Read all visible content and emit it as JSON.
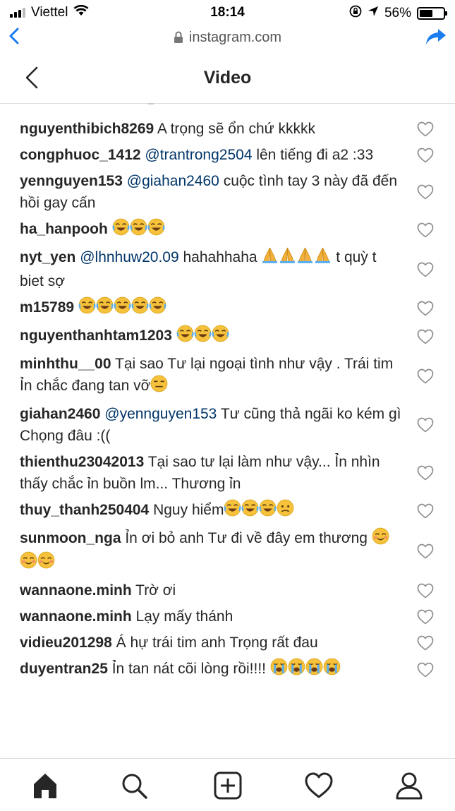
{
  "status_bar": {
    "carrier": "Viettel",
    "time": "18:14",
    "battery_text": "56%",
    "battery_level": 0.56
  },
  "browser": {
    "url": "instagram.com"
  },
  "header": {
    "title": "Video"
  },
  "comments": [
    {
      "user": "nguyenthibich8269",
      "parts": [
        {
          "t": " A trọng sẽ ổn chứ kkkkk"
        }
      ]
    },
    {
      "user": "congphuoc_1412",
      "parts": [
        {
          "t": " "
        },
        {
          "m": "@trantrong2504"
        },
        {
          "t": " lên tiếng đi a2 :33"
        }
      ]
    },
    {
      "user": "yennguyen153",
      "parts": [
        {
          "t": " "
        },
        {
          "m": "@giahan2460"
        },
        {
          "t": " cuộc tình tay 3 này đã đến hồi gay cấn"
        }
      ]
    },
    {
      "user": "ha_hanpooh",
      "parts": [
        {
          "t": " "
        },
        {
          "e": "joy"
        },
        {
          "e": "joy"
        },
        {
          "e": "joy"
        }
      ]
    },
    {
      "user": "nyt_yen",
      "parts": [
        {
          "t": " "
        },
        {
          "m": "@lhnhuw20.09"
        },
        {
          "t": " hahahhaha "
        },
        {
          "e": "pray"
        },
        {
          "e": "pray"
        },
        {
          "e": "pray"
        },
        {
          "e": "pray"
        },
        {
          "t": " t quỳ t biet sợ"
        }
      ]
    },
    {
      "user": "m15789",
      "parts": [
        {
          "t": " "
        },
        {
          "e": "joy"
        },
        {
          "e": "joy"
        },
        {
          "e": "joy"
        },
        {
          "e": "joy"
        },
        {
          "e": "joy"
        }
      ]
    },
    {
      "user": "nguyenthanhtam1203",
      "parts": [
        {
          "t": " "
        },
        {
          "e": "joy"
        },
        {
          "e": "joy"
        },
        {
          "e": "joy"
        }
      ]
    },
    {
      "user": "minhthu__00",
      "parts": [
        {
          "t": " Tại sao Tư lại ngoại tình như vậy . Trái tim Ỉn chắc đang tan vỡ"
        },
        {
          "e": "expressionless"
        }
      ]
    },
    {
      "user": "giahan2460",
      "parts": [
        {
          "t": " "
        },
        {
          "m": "@yennguyen153"
        },
        {
          "t": " Tư cũng thả ngãi ko kém gì Chọng đâu :(("
        }
      ]
    },
    {
      "user": "thienthu23042013",
      "parts": [
        {
          "t": " Tại sao tư lại làm như vậy... Ỉn nhìn thấy chắc ỉn buồn lm... Thương ỉn"
        }
      ]
    },
    {
      "user": "thuy_thanh250404",
      "parts": [
        {
          "t": " Nguy hiểm"
        },
        {
          "e": "joy"
        },
        {
          "e": "joy"
        },
        {
          "e": "joy"
        },
        {
          "e": "confused"
        }
      ]
    },
    {
      "user": "sunmoon_nga",
      "parts": [
        {
          "t": " Ỉn ơi bỏ anh Tư đi về đây em thương "
        },
        {
          "e": "blush"
        },
        {
          "e": "blush"
        },
        {
          "e": "blush"
        }
      ]
    },
    {
      "user": "wannaone.minh",
      "parts": [
        {
          "t": " Trờ ơi"
        }
      ]
    },
    {
      "user": "wannaone.minh",
      "parts": [
        {
          "t": " Lạy mấy thánh"
        }
      ]
    },
    {
      "user": "vidieu201298",
      "parts": [
        {
          "t": " Á hự trái tim anh Trọng rất đau"
        }
      ]
    },
    {
      "user": "duyentran25",
      "parts": [
        {
          "t": " Ỉn tan nát cõi lòng rồi!!!! "
        },
        {
          "e": "sob"
        },
        {
          "e": "sob"
        },
        {
          "e": "sob"
        },
        {
          "e": "sob"
        }
      ]
    }
  ],
  "nav": [
    {
      "name": "home",
      "active": true
    },
    {
      "name": "search"
    },
    {
      "name": "add"
    },
    {
      "name": "activity"
    },
    {
      "name": "profile"
    }
  ]
}
